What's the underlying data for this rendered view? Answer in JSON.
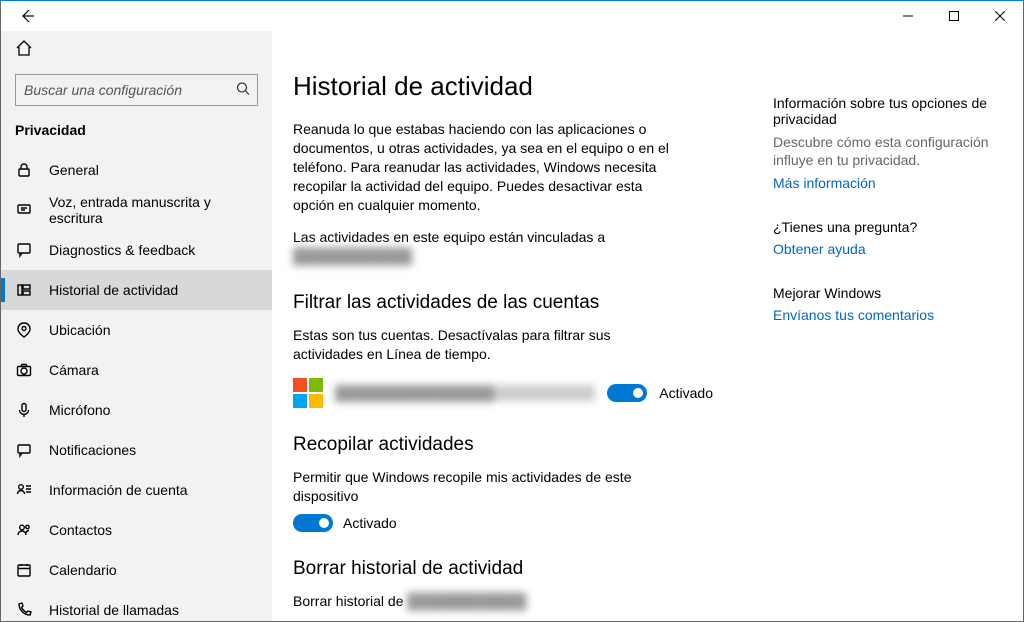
{
  "window": {
    "minimize": "–",
    "maximize": "◻",
    "close": "✕"
  },
  "search": {
    "placeholder": "Buscar una configuración"
  },
  "category": "Privacidad",
  "nav": [
    {
      "icon": "lock",
      "label": "General"
    },
    {
      "icon": "speech",
      "label": "Voz, entrada manuscrita y escritura"
    },
    {
      "icon": "diag",
      "label": "Diagnostics & feedback"
    },
    {
      "icon": "history",
      "label": "Historial de actividad"
    },
    {
      "icon": "location",
      "label": "Ubicación"
    },
    {
      "icon": "camera",
      "label": "Cámara"
    },
    {
      "icon": "mic",
      "label": "Micrófono"
    },
    {
      "icon": "notif",
      "label": "Notificaciones"
    },
    {
      "icon": "account",
      "label": "Información de cuenta"
    },
    {
      "icon": "contacts",
      "label": "Contactos"
    },
    {
      "icon": "calendar",
      "label": "Calendario"
    },
    {
      "icon": "phone",
      "label": "Historial de llamadas"
    }
  ],
  "selectedIndex": 3,
  "page": {
    "title": "Historial de actividad",
    "intro": "Reanuda lo que estabas haciendo con las aplicaciones o documentos, u otras actividades, ya sea en el equipo o en el teléfono. Para reanudar las actividades, Windows necesita recopilar la actividad del equipo. Puedes desactivar esta opción en cualquier momento.",
    "linkedPrefix": "Las actividades en este equipo están vinculadas a",
    "linkedAccount": "████████████",
    "filterHeading": "Filtrar las actividades de las cuentas",
    "filterDesc": "Estas son tus cuentas. Desactívalas para filtrar sus actividades en Línea de tiempo.",
    "accountName": "████████████████",
    "accountToggleState": "Activado",
    "collectHeading": "Recopilar actividades",
    "collectDesc": "Permitir que Windows recopile mis actividades de este dispositivo",
    "collectToggleState": "Activado",
    "clearHeading": "Borrar historial de actividad",
    "clearPrefix": "Borrar historial de",
    "clearAccount": "████████████"
  },
  "aside": {
    "privacyTitle": "Información sobre tus opciones de privacidad",
    "privacyDesc": "Descubre cómo esta configuración influye en tu privacidad.",
    "moreInfo": "Más información",
    "questionTitle": "¿Tienes una pregunta?",
    "getHelp": "Obtener ayuda",
    "improveTitle": "Mejorar Windows",
    "feedback": "Envíanos tus comentarios"
  }
}
